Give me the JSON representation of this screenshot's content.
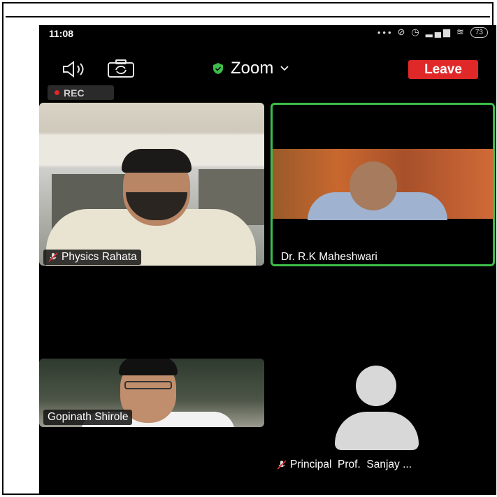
{
  "status_bar": {
    "time": "11:08",
    "icons": [
      "dots-icon",
      "no-notification-icon",
      "alarm-icon",
      "volte-icon",
      "signal-icon",
      "signal-icon",
      "wifi-icon",
      "battery-icon"
    ],
    "battery_level": "73"
  },
  "header": {
    "app_title": "Zoom",
    "leave_label": "Leave",
    "rec_label": "REC",
    "colors": {
      "leave": "#e02828",
      "shield": "#3dbd4a",
      "active_speaker_border": "#3dbd4a"
    }
  },
  "participants": [
    {
      "name": "Physics Rahata",
      "muted": true,
      "video": true
    },
    {
      "name": "Dr. R.K Maheshwari",
      "muted": false,
      "video": true,
      "active_speaker": true
    },
    {
      "name": "Gopinath Shirole",
      "muted": false,
      "video": true
    },
    {
      "name": "Principal  Prof.  Sanjay ...",
      "muted": true,
      "video": false
    }
  ]
}
